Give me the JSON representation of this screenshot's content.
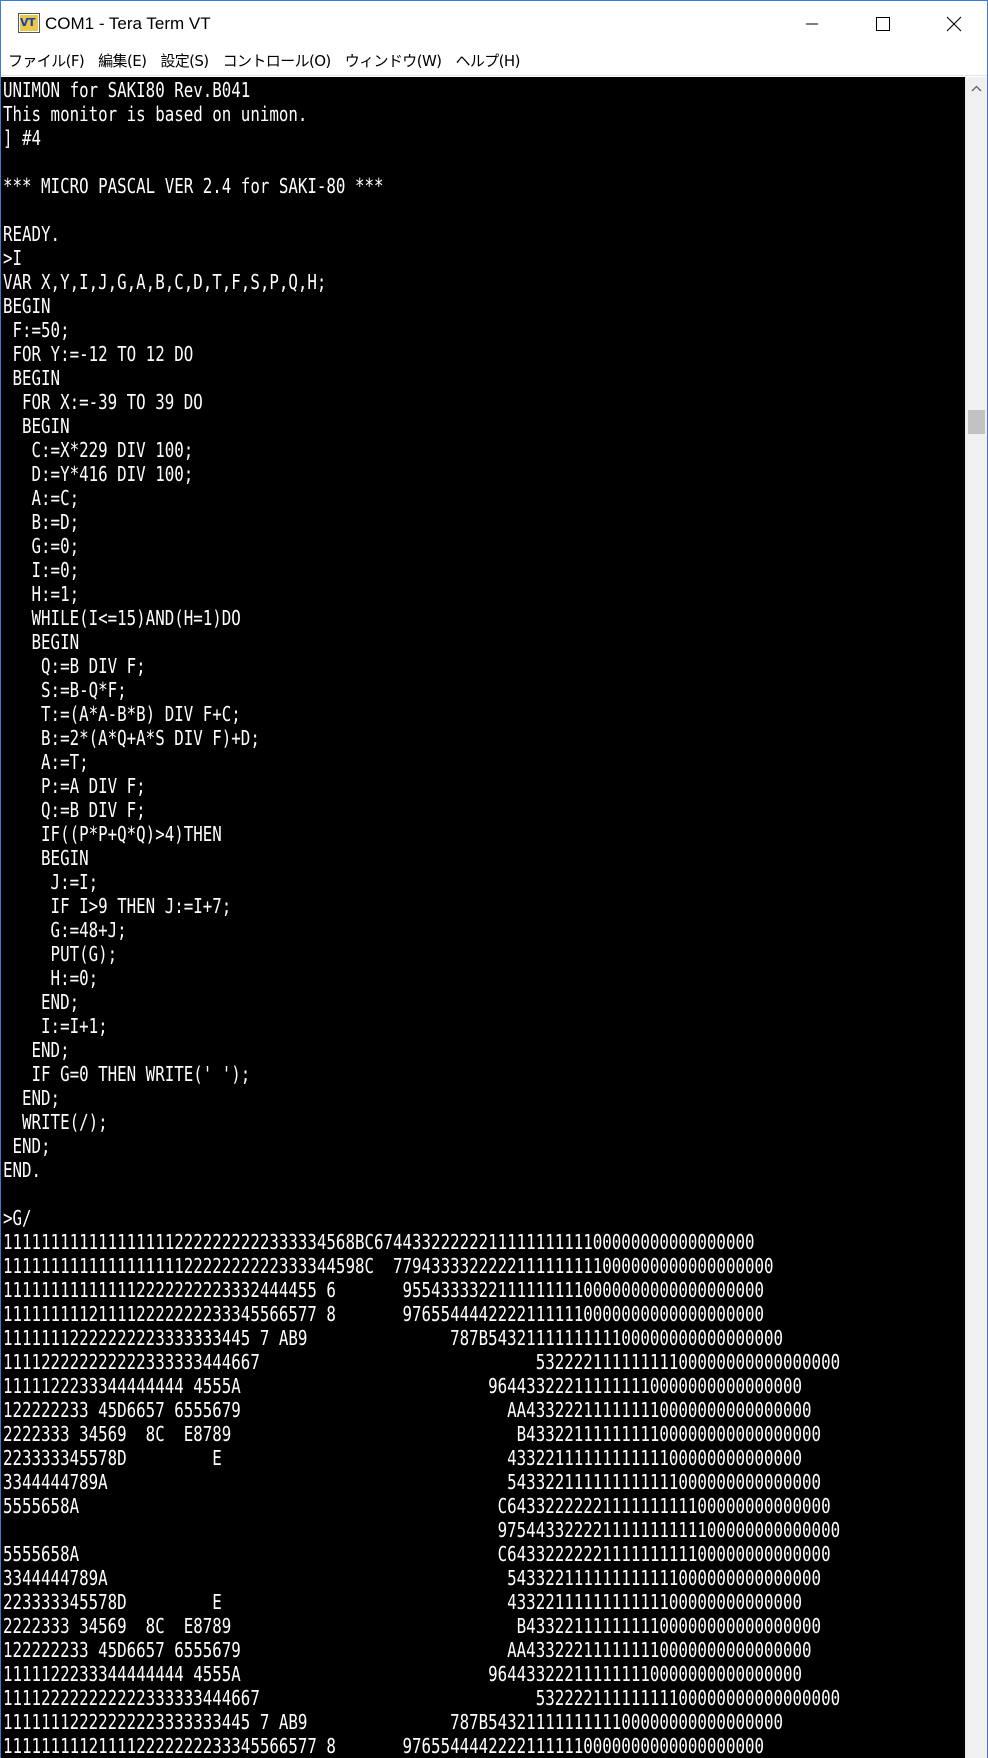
{
  "window": {
    "title": "COM1 - Tera Term VT",
    "icon_text": "VT",
    "controls": {
      "minimize": "minimize-icon",
      "maximize": "maximize-icon",
      "close": "close-icon"
    }
  },
  "menu": [
    "ファイル(F)",
    "編集(E)",
    "設定(S)",
    "コントロール(O)",
    "ウィンドウ(W)",
    "ヘルプ(H)"
  ],
  "terminal": {
    "background": "#000000",
    "foreground": "#ffffff",
    "lines": [
      "UNIMON for SAKI80 Rev.B041",
      "This monitor is based on unimon.",
      "] #4",
      "",
      "*** MICRO PASCAL VER 2.4 for SAKI-80 ***",
      "",
      "READY.",
      ">I",
      "VAR X,Y,I,J,G,A,B,C,D,T,F,S,P,Q,H;",
      "BEGIN",
      " F:=50;",
      " FOR Y:=-12 TO 12 DO",
      " BEGIN",
      "  FOR X:=-39 TO 39 DO",
      "  BEGIN",
      "   C:=X*229 DIV 100;",
      "   D:=Y*416 DIV 100;",
      "   A:=C;",
      "   B:=D;",
      "   G:=0;",
      "   I:=0;",
      "   H:=1;",
      "   WHILE(I<=15)AND(H=1)DO",
      "   BEGIN",
      "    Q:=B DIV F;",
      "    S:=B-Q*F;",
      "    T:=(A*A-B*B) DIV F+C;",
      "    B:=2*(A*Q+A*S DIV F)+D;",
      "    A:=T;",
      "    P:=A DIV F;",
      "    Q:=B DIV F;",
      "    IF((P*P+Q*Q)>4)THEN",
      "    BEGIN",
      "     J:=I;",
      "     IF I>9 THEN J:=I+7;",
      "     G:=48+J;",
      "     PUT(G);",
      "     H:=0;",
      "    END;",
      "    I:=I+1;",
      "   END;",
      "   IF G=0 THEN WRITE(' ');",
      "  END;",
      "  WRITE(/);",
      " END;",
      "END.",
      "",
      ">G/",
      "1111111111111111112222222222333334568BC6744332222221111111111100000000000000000",
      "11111111111111111112222222222333344598C  7794333322222111111111000000000000000000",
      "111111111111112222222223332444455 6       95543333221111111110000000000000000000",
      "111111111211112222222233345566577 8       97655444422221111110000000000000000000",
      "11111112222222223333333445 7 AB9               787B5432111111111100000000000000000",
      "111122222222222333333444667                             53222211111111100000000000000000",
      "1111122233344444444 4555A                          964433222111111110000000000000000",
      "122222233 45D6657 6555679                            AA433222111111110000000000000000",
      "2222333 34569  8C  E8789                              B4332211111111100000000000000000",
      "223333345578D         E                              4332211111111111100000000000000",
      "3344444789A                                          543322111111111111000000000000000",
      "5555658A                                            C6433222222111111111100000000000000",
      "                                                    975443322221111111111100000000000000",
      "5555658A                                            C6433222222111111111100000000000000",
      "3344444789A                                          543322111111111111000000000000000",
      "223333345578D         E                              4332211111111111100000000000000",
      "2222333 34569  8C  E8789                              B4332211111111100000000000000000",
      "122222233 45D6657 6555679                            AA433222111111110000000000000000",
      "1111122233344444444 4555A                          964433222111111110000000000000000",
      "111122222222222333333444667                             53222211111111100000000000000000",
      "11111112222222223333333445 7 AB9               787B5432111111111100000000000000000",
      "111111111211112222222233345566577 8       97655444422221111110000000000000000000"
    ]
  }
}
